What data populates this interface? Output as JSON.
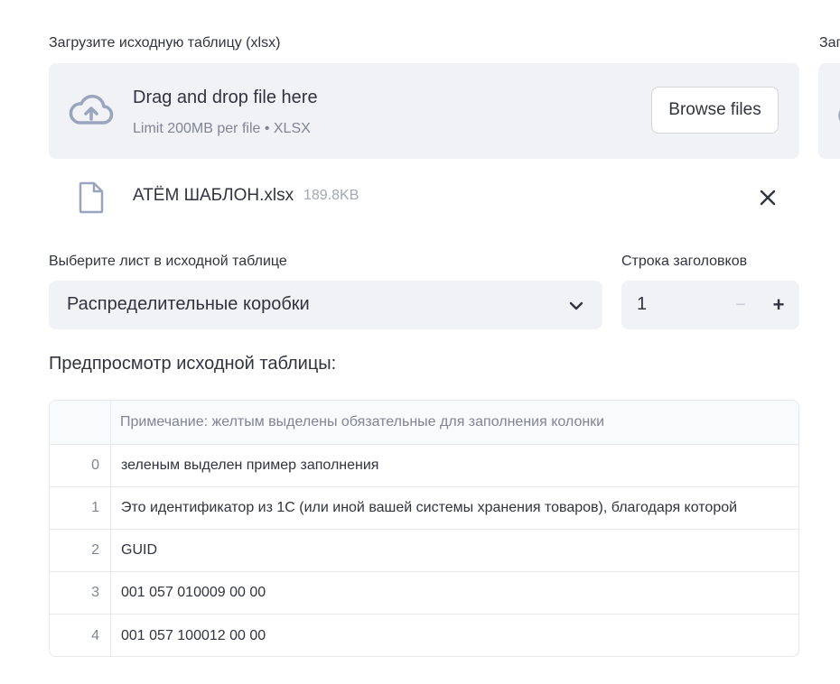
{
  "uploader": {
    "label": "Загрузите исходную таблицу (xlsx)",
    "dropzone_title": "Drag and drop file here",
    "dropzone_limit": "Limit 200MB per file • XLSX",
    "browse_label": "Browse files",
    "file_name": "АТЁМ ШАБЛОН.xlsx",
    "file_size": "189.8KB"
  },
  "second_uploader": {
    "label": "Заг"
  },
  "sheet_select": {
    "label": "Выберите лист в исходной таблице",
    "value": "Распределительные коробки"
  },
  "header_row": {
    "label": "Строка заголовков",
    "value": "1",
    "minus": "−",
    "plus": "+"
  },
  "preview": {
    "title": "Предпросмотр исходной таблицы:",
    "column_header": "Примечание: желтым выделены обязательные для заполнения колонки",
    "rows": [
      {
        "index": "0",
        "value": "зеленым выделен пример заполнения"
      },
      {
        "index": "1",
        "value": "Это идентификатор из 1С (или иной вашей системы хранения товаров), благодаря которой"
      },
      {
        "index": "2",
        "value": "GUID"
      },
      {
        "index": "3",
        "value": "001 057 010009 00 00"
      },
      {
        "index": "4",
        "value": "001 057 100012 00 00"
      }
    ]
  },
  "colors": {
    "input_bg": "#f0f2f6",
    "text": "#31333f",
    "muted": "#808495",
    "icon": "#9aa4bd"
  },
  "icons": {
    "upload": "cloud-upload-icon",
    "file": "file-icon",
    "remove": "close-icon",
    "select": "chevron-down-icon"
  }
}
